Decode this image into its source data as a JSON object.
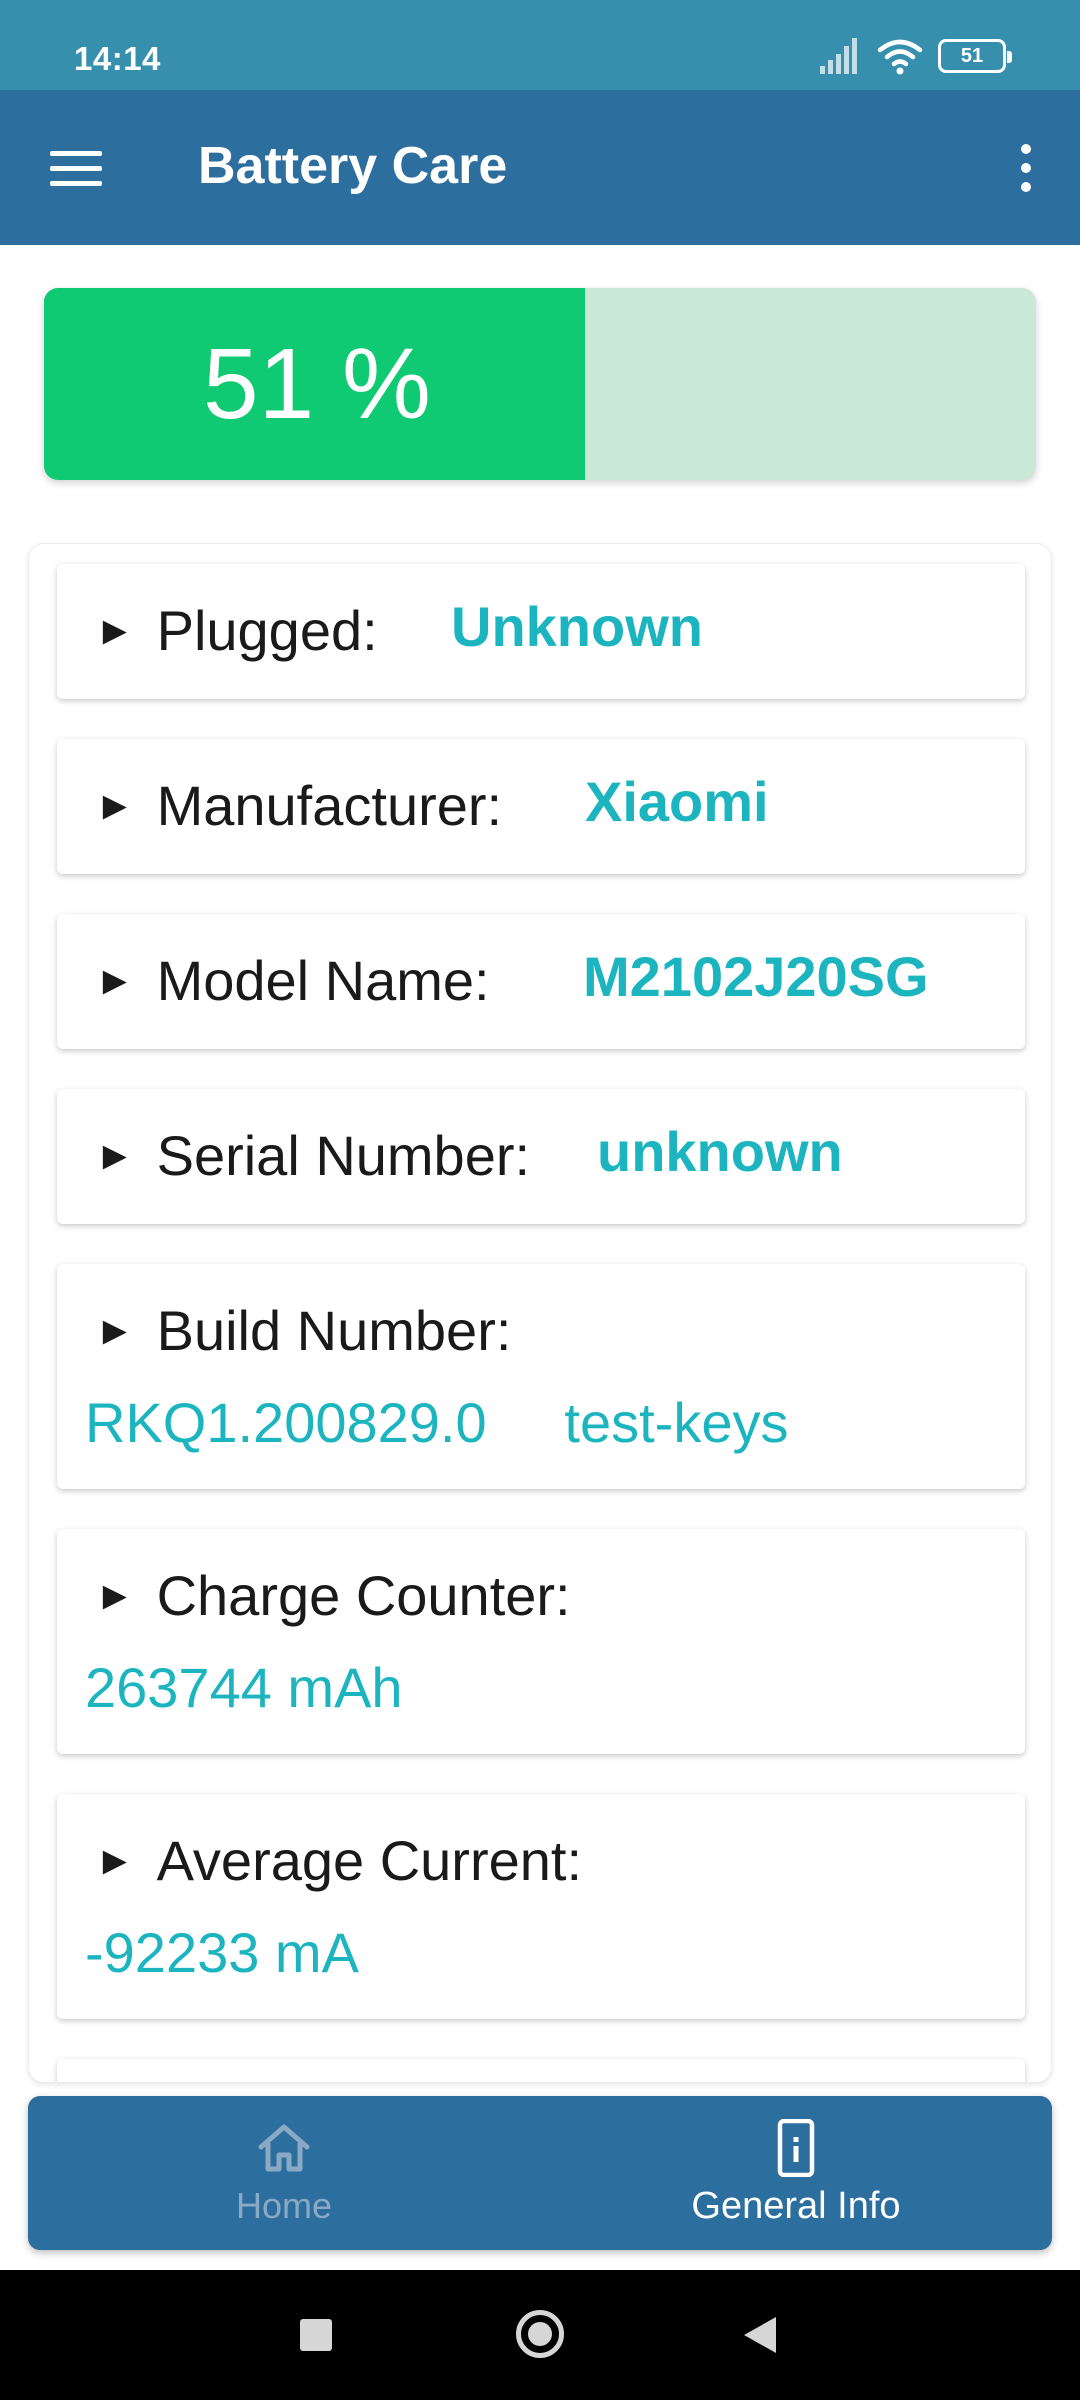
{
  "status_bar": {
    "time": "14:14",
    "battery_level": "51",
    "icons": [
      "signal-icon",
      "wifi-icon",
      "battery-icon"
    ]
  },
  "app_bar": {
    "title": "Battery Care",
    "menu_icon": "hamburger-menu-icon",
    "overflow_icon": "more-vertical-icon"
  },
  "battery": {
    "percent_label": "51 %",
    "level_fraction": 0.51,
    "fill_color": "#0fca72",
    "track_color": "#c9e8d6"
  },
  "info": {
    "arrow": "►",
    "rows": [
      {
        "label": "Plugged:",
        "value": "Unknown"
      },
      {
        "label": "Manufacturer:",
        "value": "Xiaomi"
      },
      {
        "label": "Model Name:",
        "value": "M2102J20SG"
      },
      {
        "label": "Serial Number:",
        "value": "unknown"
      },
      {
        "label": "Build Number:",
        "value": "RKQ1.200829.0     test-keys"
      },
      {
        "label": "Charge Counter:",
        "value": "263744 mAh"
      },
      {
        "label": "Average Current:",
        "value": "-92233 mA"
      }
    ],
    "value_color": "#1cb5bf"
  },
  "bottom_nav": {
    "items": [
      {
        "label": "Home",
        "icon": "home-icon",
        "active": false
      },
      {
        "label": "General Info",
        "icon": "phone-info-icon",
        "active": true
      }
    ]
  },
  "system_nav": {
    "icons": [
      "recents-icon",
      "home-circle-icon",
      "back-icon"
    ]
  },
  "colors": {
    "status_bar": "#3690ad",
    "app_bar": "#2c6e9e",
    "accent": "#1cb5bf"
  }
}
